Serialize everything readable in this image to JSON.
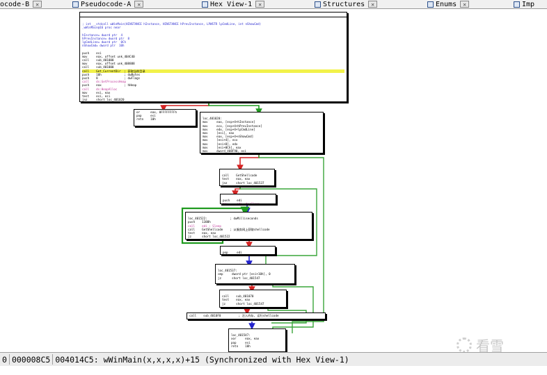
{
  "tabs": [
    {
      "label": "ocode-B",
      "icon": "pseudocode-icon"
    },
    {
      "label": "Pseudocode-A",
      "icon": "pseudocode-icon"
    },
    {
      "label": "Hex View-1",
      "icon": "hex-view-icon"
    },
    {
      "label": "Structures",
      "icon": "structures-icon"
    },
    {
      "label": "Enums",
      "icon": "enums-icon"
    },
    {
      "label": "Imp",
      "icon": "imports-icon"
    }
  ],
  "graph": {
    "blocks": [
      {
        "title": true,
        "lines": [
          {
            "t": ""
          },
          {
            "t": "; int __stdcall wWinMain(HINSTANCE hInstance, HINSTANCE hPrevInstance, LPWSTR lpCmdLine, int nShowCmd)",
            "c": "blue"
          },
          {
            "t": "_wWinMain@16 proc near",
            "c": "blue"
          },
          {
            "t": ""
          },
          {
            "t": "hInstance= dword ptr  4",
            "c": "blue"
          },
          {
            "t": "hPrevInstance= dword ptr  8",
            "c": "blue"
          },
          {
            "t": "lpCmdLine= dword ptr  0Ch",
            "c": "blue"
          },
          {
            "t": "nShowCmd= dword ptr  10h",
            "c": "blue"
          },
          {
            "t": ""
          },
          {
            "t": "push    esi"
          },
          {
            "t": "mov     eax, offset unk_404C40"
          },
          {
            "t": "call    sub_401000"
          },
          {
            "t": "mov     eax, offset unk_408888"
          },
          {
            "t": "call    sub_401000"
          },
          {
            "t": "call    Get_CurrentDir  ; 获取当前目录",
            "c": "hl"
          },
          {
            "t": "push    10h             ; dwBytes"
          },
          {
            "t": "push    8               ; dwFlags"
          },
          {
            "t": "call    ds:GetProcessHeap",
            "c": "pink"
          },
          {
            "t": "push    eax             ; hHeap"
          },
          {
            "t": "call    ds:HeapAlloc",
            "c": "pink"
          },
          {
            "t": "mov     esi, eax"
          },
          {
            "t": "test    esi, esi"
          },
          {
            "t": "jnz     short loc_401020"
          }
        ]
      },
      {
        "lines": [
          {
            "t": "or      eax, 0FFFFFFFFh"
          },
          {
            "t": "pop     esi"
          },
          {
            "t": "retn    10h"
          }
        ]
      },
      {
        "lines": [
          {
            "t": ""
          },
          {
            "t": "loc_401020:"
          },
          {
            "t": "mov     eax, [esp+4+hInstance]"
          },
          {
            "t": "mov     ecx, [esp+4+hPrevInstance]"
          },
          {
            "t": "mov     edx, [esp+4+lpCmdLine]"
          },
          {
            "t": "mov     [esi], eax"
          },
          {
            "t": "mov     eax, [esp+4+nShowCmd]"
          },
          {
            "t": "mov     [esi+4], ecx"
          },
          {
            "t": "mov     [esi+8], edx"
          },
          {
            "t": "mov     [esi+0Ch], eax"
          },
          {
            "t": "mov     dword_408F90, esi"
          },
          {
            "t": "call    Get_local_shellcode ; 获取本地shellcode"
          },
          {
            "t": "test    eax, eax"
          },
          {
            "t": "jnz     short loc_401522"
          }
        ]
      },
      {
        "lines": [
          {
            "t": ""
          },
          {
            "t": "call    GetShellcode"
          },
          {
            "t": "test    eax, eax"
          },
          {
            "t": "jnz     short loc_401537"
          }
        ]
      },
      {
        "lines": [
          {
            "t": ""
          },
          {
            "t": "push    edi"
          },
          {
            "t": "mov     edi, ds:Sleep",
            "c": "pink"
          }
        ]
      },
      {
        "lines": [
          {
            "t": ""
          },
          {
            "t": "loc_401522:             ; dwMilliseconds"
          },
          {
            "t": "push    1388h"
          },
          {
            "t": "call    edi ; Sleep",
            "c": "pink"
          },
          {
            "t": "call    GetShellcode    ; 从服务网上获取shellcode"
          },
          {
            "t": "test    eax, eax"
          },
          {
            "t": "jz      short loc_401522"
          }
        ]
      },
      {
        "lines": [
          {
            "t": ""
          },
          {
            "t": "pop     edi"
          }
        ]
      },
      {
        "lines": [
          {
            "t": ""
          },
          {
            "t": "loc_401537:"
          },
          {
            "t": "cmp     dword ptr [esi+10h], 0"
          },
          {
            "t": "jz      short loc_401547"
          }
        ]
      },
      {
        "lines": [
          {
            "t": ""
          },
          {
            "t": "call    sub_401070"
          },
          {
            "t": "test    eax, eax"
          },
          {
            "t": "jz      short loc_401547"
          }
        ]
      },
      {
        "lines": [
          {
            "t": "call    sub_4010F0          ; 注入内存, 运行shellcode"
          }
        ]
      },
      {
        "lines": [
          {
            "t": ""
          },
          {
            "t": "loc_401547:"
          },
          {
            "t": "xor     eax, eax"
          },
          {
            "t": "pop     esi"
          },
          {
            "t": "retn    10h"
          }
        ]
      }
    ]
  },
  "status": {
    "field0": "0",
    "offset": "000008C5",
    "address": "004014C5: wWinMain(x,x,x,x)+15 (Synchronized with Hex View-1)"
  },
  "watermark": {
    "text": "看雪",
    "icon": "kanxue-logo-icon"
  },
  "colors": {
    "edge_true": "#1f9a1f",
    "edge_false": "#d42424",
    "edge_uncond": "#2222cc",
    "edge_back": "#3aa53a"
  }
}
